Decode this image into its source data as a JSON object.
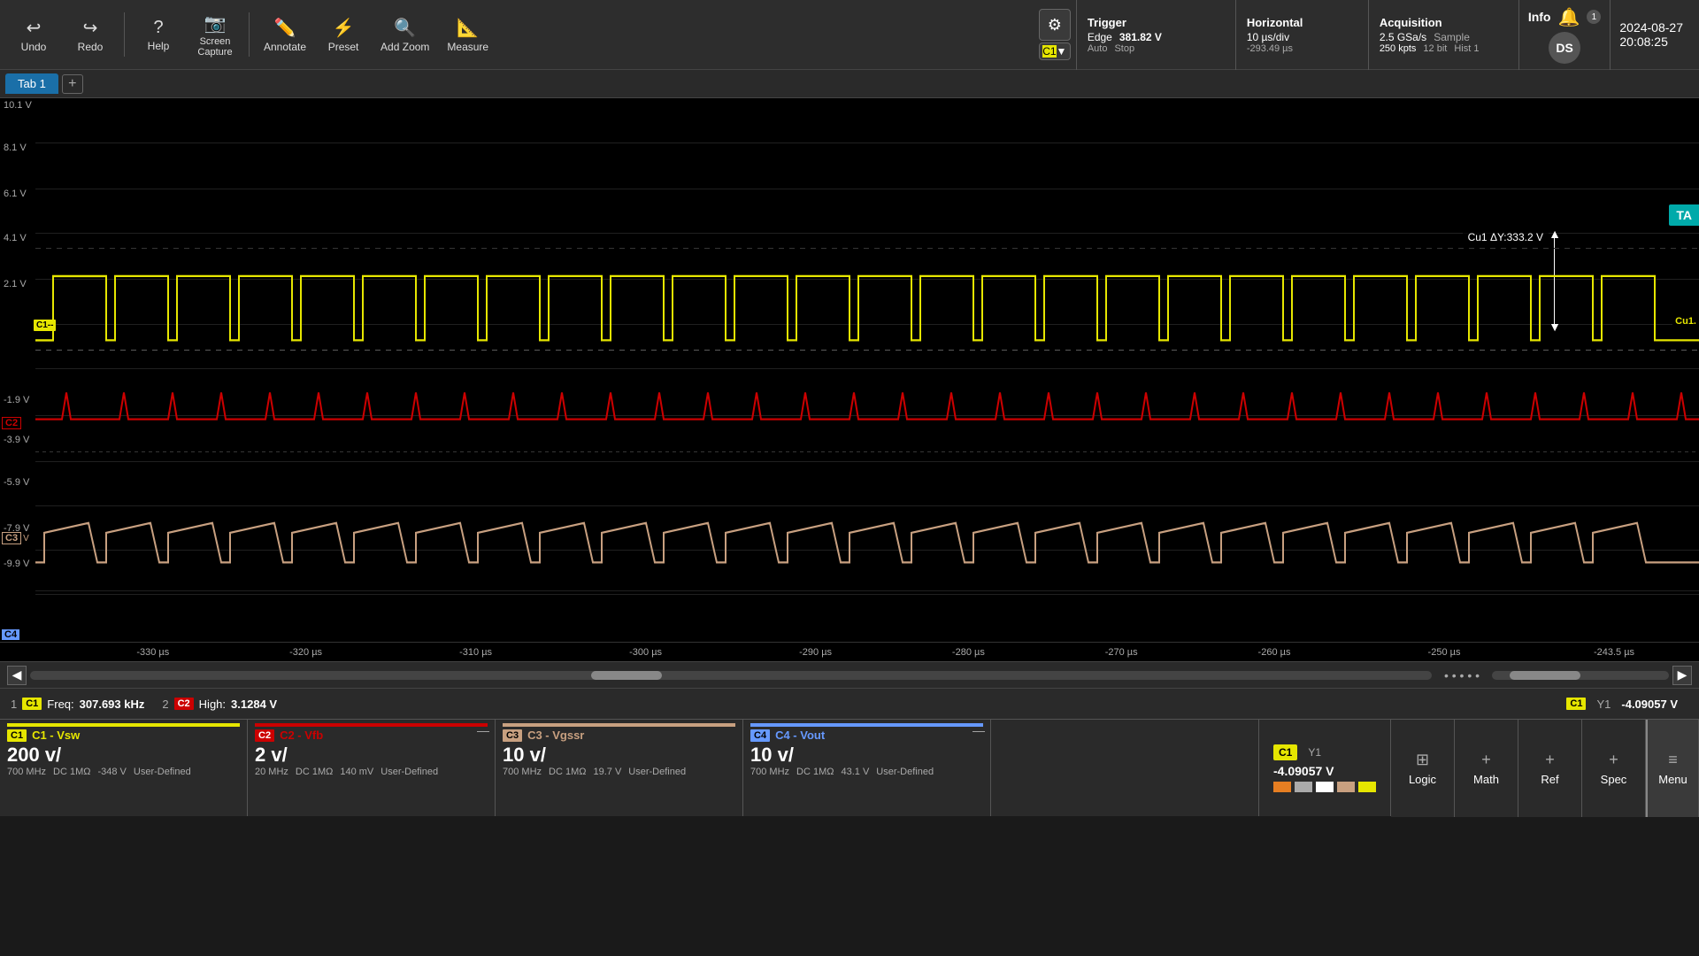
{
  "toolbar": {
    "undo_label": "Undo",
    "redo_label": "Redo",
    "help_label": "Help",
    "screen_capture_label": "Screen\nCapture",
    "annotate_label": "Annotate",
    "preset_label": "Preset",
    "add_zoom_label": "Add Zoom",
    "measure_label": "Measure"
  },
  "trigger": {
    "title": "Trigger",
    "type": "Edge",
    "value": "381.82 V",
    "mode": "Auto",
    "state": "Stop"
  },
  "horizontal": {
    "title": "Horizontal",
    "div": "10 µs/div",
    "pts": "250 kpts",
    "pos": "-293.49 µs"
  },
  "acquisition": {
    "title": "Acquisition",
    "mode": "Sample",
    "bits": "12 bit",
    "hist": "Hist 1",
    "rate": "2.5 GSa/s"
  },
  "info": {
    "title": "Info"
  },
  "datetime": {
    "date": "2024-08-27",
    "time": "20:08:25"
  },
  "tab": {
    "name": "Tab 1"
  },
  "y_labels": [
    "10.1 V",
    "8.1 V",
    "6.1 V",
    "4.1 V",
    "2.1 V",
    "-1.9 V",
    "-3.9 V",
    "-5.9 V",
    "-7.9 V",
    "-9.9 V"
  ],
  "time_labels": [
    "-330 µs",
    "-320 µs",
    "-310 µs",
    "-300 µs",
    "-290 µs",
    "-280 µs",
    "-270 µs",
    "-260 µs",
    "-250 µs",
    "-243.5 µs"
  ],
  "cursor": {
    "label": "Cu1 ΔY:333.2 V"
  },
  "measurements": [
    {
      "num": "1",
      "ch": "C1",
      "name": "Freq:",
      "value": "307.693 kHz"
    },
    {
      "num": "2",
      "ch": "C2",
      "name": "High:",
      "value": "3.1284 V"
    }
  ],
  "right_meas": {
    "ch": "C1",
    "label": "Y1",
    "value": "-4.09057 V"
  },
  "channels": [
    {
      "id": "C1",
      "name": "C1 - Vsw",
      "color": "yellow",
      "main_val": "200 v/",
      "sub1": "700 MHz",
      "sub2": "DC 1MΩ",
      "sub3": "-348 V",
      "sub4": "User-Defined"
    },
    {
      "id": "C2",
      "name": "C2 - Vfb",
      "color": "red",
      "main_val": "2 v/",
      "sub1": "20 MHz",
      "sub2": "DC 1MΩ",
      "sub3": "140 mV",
      "sub4": "User-Defined"
    },
    {
      "id": "C3",
      "name": "C3 - Vgssr",
      "color": "pink",
      "main_val": "10 v/",
      "sub1": "700 MHz",
      "sub2": "DC 1MΩ",
      "sub3": "19.7 V",
      "sub4": "User-Defined"
    },
    {
      "id": "C4",
      "name": "C4 - Vout",
      "color": "blue",
      "main_val": "10 v/",
      "sub1": "700 MHz",
      "sub2": "DC 1MΩ",
      "sub3": "43.1 V",
      "sub4": "User-Defined"
    }
  ],
  "func_buttons": {
    "logic": "Logic",
    "math": "Math",
    "ref": "Ref",
    "spec": "Spec",
    "menu": "Menu"
  }
}
